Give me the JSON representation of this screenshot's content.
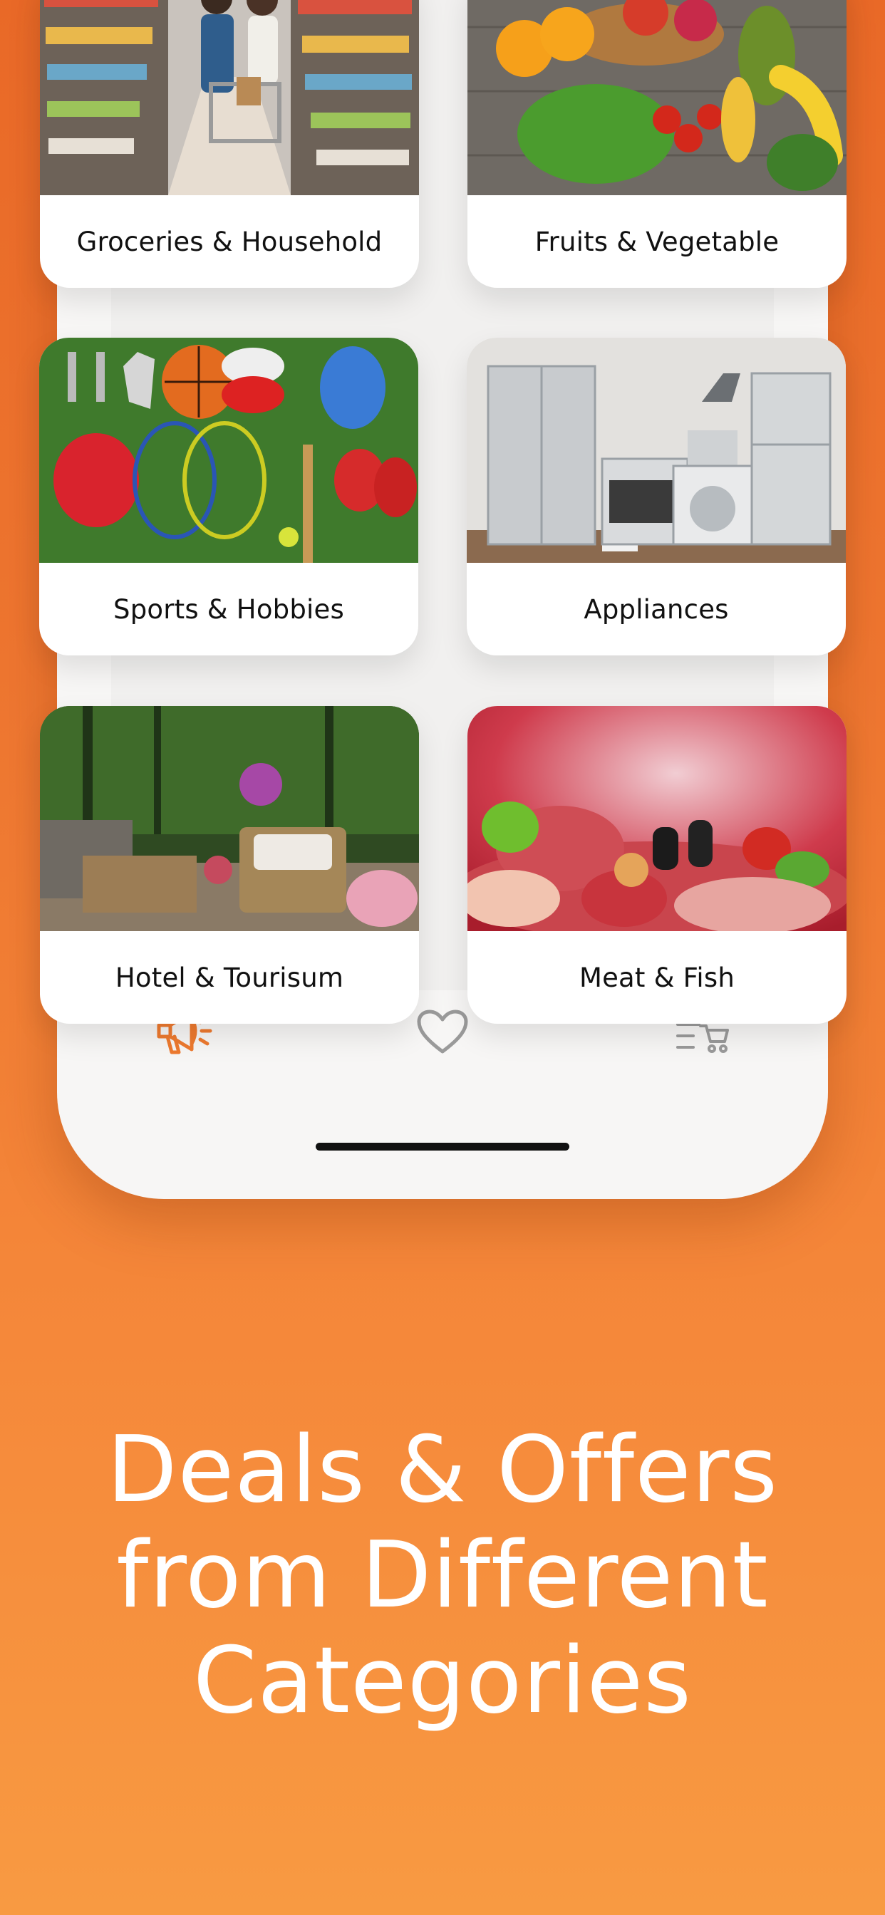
{
  "categories": [
    {
      "label": "Groceries & Household",
      "image": "supermarket-aisle-photo"
    },
    {
      "label": "Fruits & Vegetable",
      "image": "fruit-basket-photo"
    },
    {
      "label": "Sports & Hobbies",
      "image": "sports-equipment-photo"
    },
    {
      "label": "Appliances",
      "image": "home-appliances-photo"
    },
    {
      "label": "Hotel & Tourisum",
      "image": "patio-garden-photo"
    },
    {
      "label": "Meat & Fish",
      "image": "raw-meat-photo"
    }
  ],
  "nav": {
    "items": [
      {
        "icon": "megaphone-icon",
        "active": true
      },
      {
        "icon": "heart-icon",
        "active": false
      },
      {
        "icon": "cart-list-icon",
        "active": false
      }
    ],
    "active_color": "#ee7a2f",
    "inactive_color": "#9a9a9a"
  },
  "headline": {
    "line1": "Deals & Offers",
    "line2": "from Different",
    "line3": "Categories"
  },
  "colors": {
    "background_top": "#ea6a28",
    "background_bottom": "#f89a42",
    "accent": "#ee7a2f"
  }
}
